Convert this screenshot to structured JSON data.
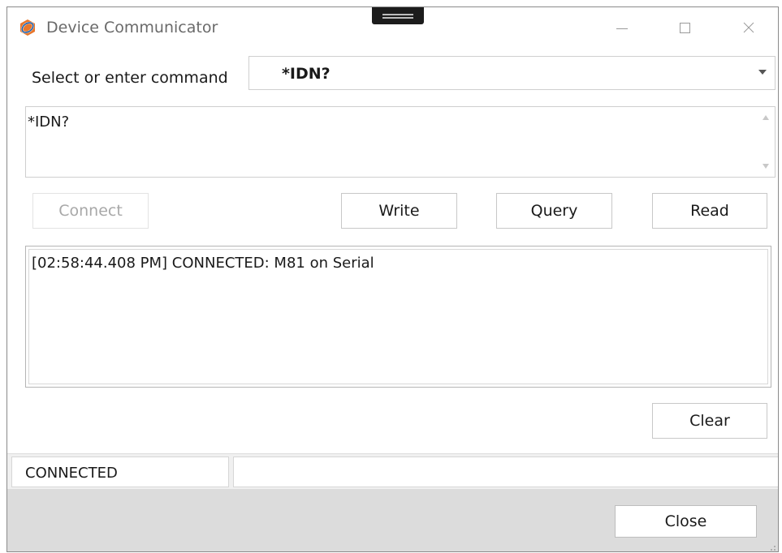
{
  "window": {
    "title": "Device Communicator",
    "icon": "app-logo-icon"
  },
  "titlebar_controls": [
    "minimize-icon",
    "maximize-icon",
    "close-icon"
  ],
  "command": {
    "label": "Select or enter command",
    "selected": "*IDN?",
    "text": "*IDN?"
  },
  "buttons": {
    "connect": "Connect",
    "write": "Write",
    "query": "Query",
    "read": "Read",
    "clear": "Clear",
    "close": "Close"
  },
  "log": {
    "lines": [
      "[02:58:44.408 PM] CONNECTED: M81 on Serial"
    ]
  },
  "status": {
    "state": "CONNECTED",
    "detail": ""
  },
  "colors": {
    "accent_orange": "#e8762b",
    "accent_blue": "#1f5fa8",
    "disabled_text": "#a8a8a8"
  }
}
